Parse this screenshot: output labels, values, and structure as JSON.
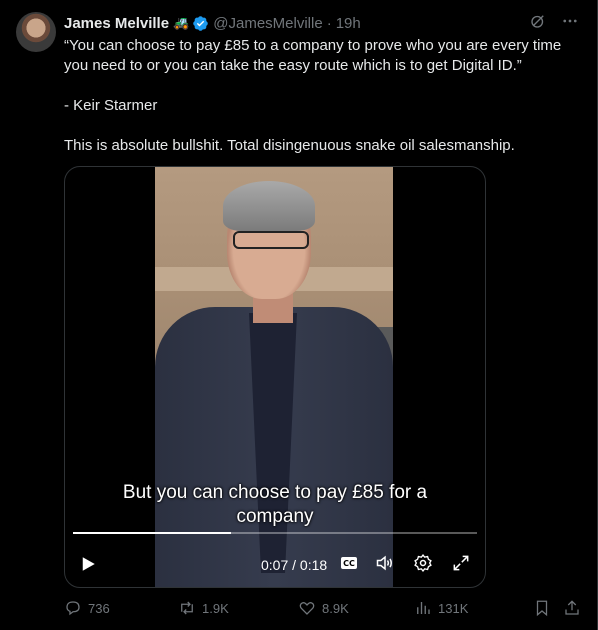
{
  "author": {
    "name": "James Melville",
    "emoji": "🚜",
    "handle": "@JamesMelville",
    "separator": "·",
    "time": "19h"
  },
  "tweet": {
    "line1": "“You can choose to pay £85 to a company to prove who you are every time you need to or you can take the easy route which is to get Digital ID.”",
    "line2": "- Keir Starmer",
    "line3": "This is absolute bullshit. Total disingenuous snake oil salesmanship."
  },
  "video": {
    "caption_line1": "But you can choose to pay £85 for a",
    "caption_line2": "company",
    "time_display": "0:07 / 0:18",
    "progress": 0.39,
    "cc_label": "CC"
  },
  "actions": {
    "replies": "736",
    "reposts": "1.9K",
    "likes": "8.9K",
    "views": "131K"
  },
  "colors": {
    "background": "#000000",
    "text": "#e7e9ea",
    "muted": "#71767b",
    "verified": "#1d9bf0",
    "border": "#2f3336"
  }
}
